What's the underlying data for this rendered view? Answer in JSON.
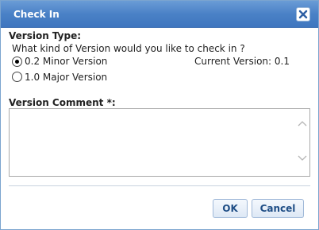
{
  "dialog": {
    "title": "Check In",
    "close_icon": "close-icon"
  },
  "version_type": {
    "label": "Version Type:",
    "question": "What kind of Version would you like to check in ?",
    "options": [
      {
        "label": "0.2 Minor Version",
        "selected": true
      },
      {
        "label": "1.0 Major Version",
        "selected": false
      }
    ],
    "current_version": "Current Version: 0.1"
  },
  "comment": {
    "label": "Version Comment *:",
    "value": ""
  },
  "buttons": {
    "ok": "OK",
    "cancel": "Cancel"
  },
  "colors": {
    "titlebar": "#4a81c6",
    "button_text": "#1f4e86"
  }
}
